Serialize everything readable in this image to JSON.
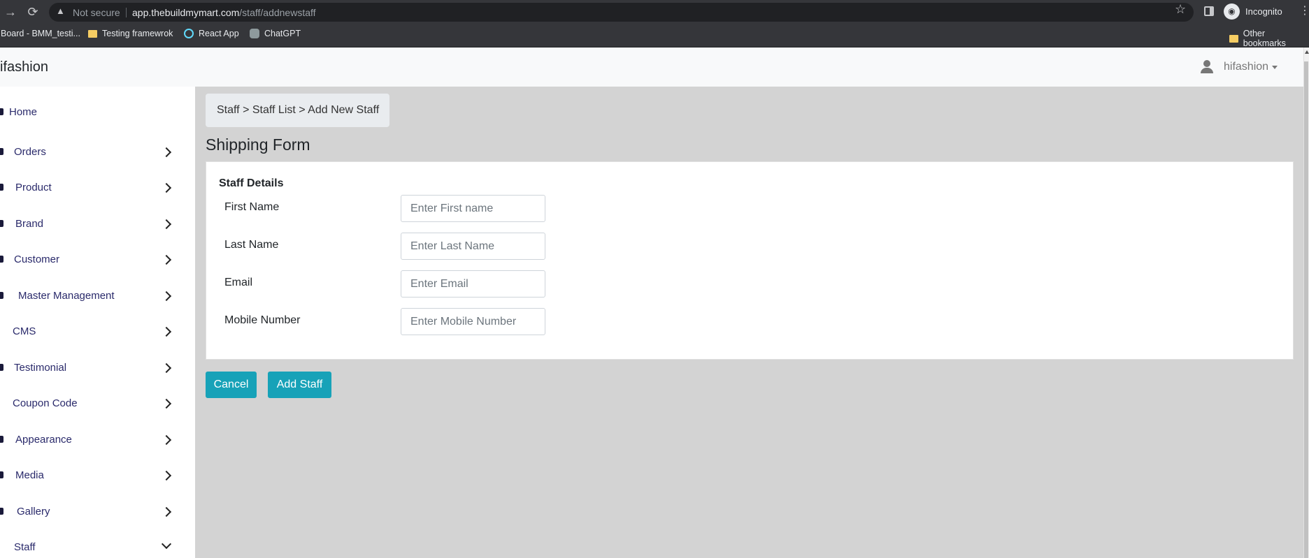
{
  "browser": {
    "security_label": "Not secure",
    "url_host": "app.thebuildmymart.com",
    "url_path": "/staff/addnewstaff",
    "incognito_label": "Incognito",
    "bookmarks": [
      "Board - BMM_testi...",
      "Testing framewrok",
      "React App",
      "ChatGPT"
    ],
    "other_bookmarks": "Other bookmarks"
  },
  "header": {
    "brand": "ifashion",
    "user": "hifashion"
  },
  "sidebar": {
    "items": [
      {
        "label": "Home",
        "has_chevron": false
      },
      {
        "label": "Orders",
        "has_chevron": true
      },
      {
        "label": "Product",
        "has_chevron": true
      },
      {
        "label": "Brand",
        "has_chevron": true
      },
      {
        "label": "Customer",
        "has_chevron": true
      },
      {
        "label": "Master Management",
        "has_chevron": true
      },
      {
        "label": "CMS",
        "has_chevron": true
      },
      {
        "label": "Testimonial",
        "has_chevron": true
      },
      {
        "label": "Coupon Code",
        "has_chevron": true
      },
      {
        "label": "Appearance",
        "has_chevron": true
      },
      {
        "label": "Media",
        "has_chevron": true
      },
      {
        "label": "Gallery",
        "has_chevron": true
      },
      {
        "label": "Staff",
        "has_chevron": true,
        "expanded": true
      }
    ]
  },
  "main": {
    "breadcrumb": "Staff > Staff List > Add New Staff",
    "title": "Shipping Form",
    "card_title": "Staff Details",
    "fields": [
      {
        "label": "First Name",
        "placeholder": "Enter First name",
        "value": ""
      },
      {
        "label": "Last Name",
        "placeholder": "Enter Last Name",
        "value": ""
      },
      {
        "label": "Email",
        "placeholder": "Enter Email",
        "value": ""
      },
      {
        "label": "Mobile Number",
        "placeholder": "Enter Mobile Number",
        "value": ""
      }
    ],
    "cancel_label": "Cancel",
    "add_label": "Add Staff"
  },
  "colors": {
    "accent": "#17a2b8",
    "sidebar_text": "#2a2a6b",
    "content_bg": "#d3d3d3"
  }
}
